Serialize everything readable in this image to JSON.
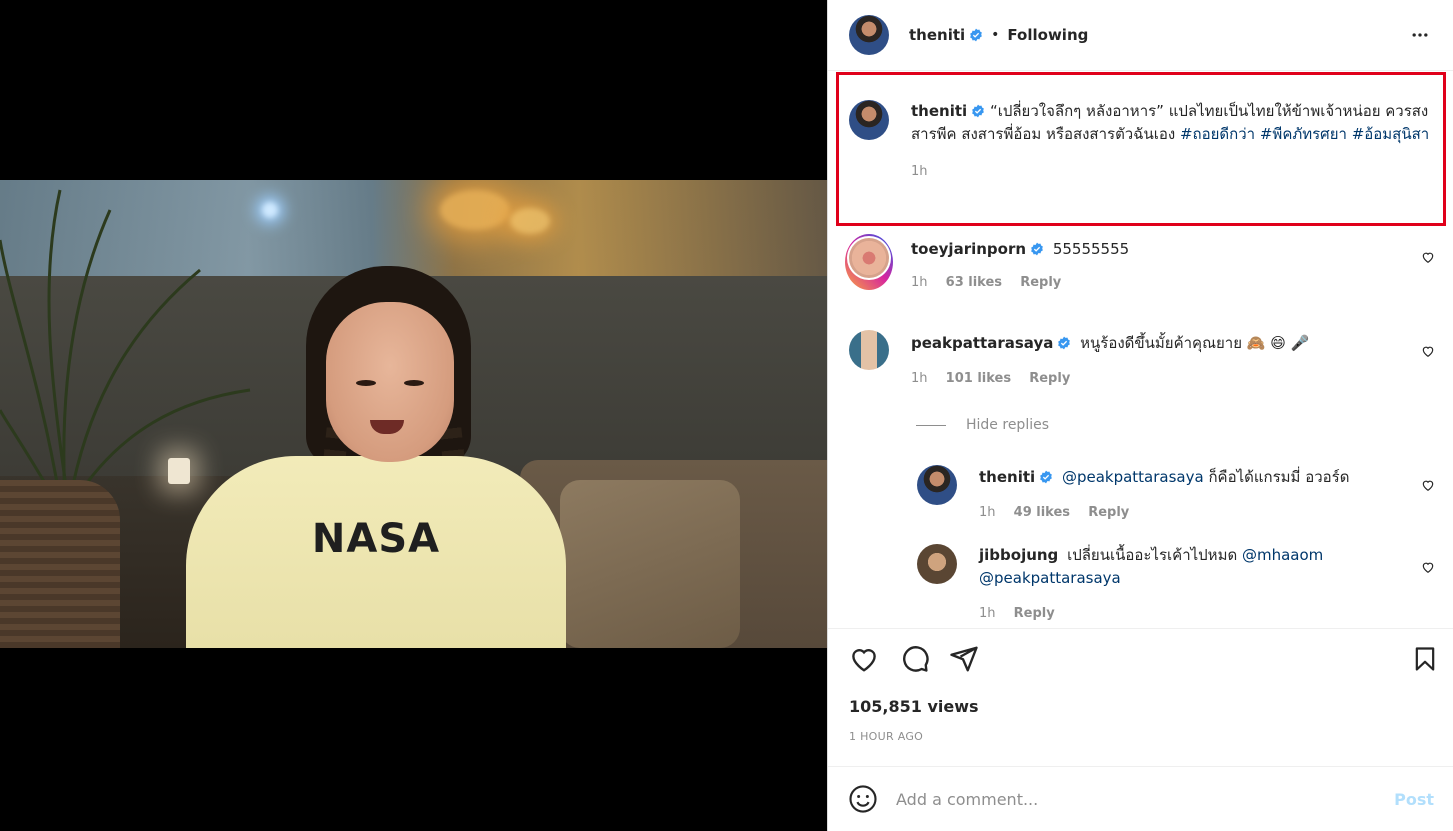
{
  "video": {
    "shirt_text": "NASA"
  },
  "header": {
    "username": "theniti",
    "separator": "•",
    "follow_status": "Following",
    "more_icon": "more-horizontal-icon"
  },
  "caption": {
    "username": "theniti",
    "text": "“เปลี่ยวใจลึกๆ หลังอาหาร” แปลไทยเป็นไทยให้ข้าพเจ้าหน่อย ควรสงสารพีค สงสารพี่อ้อม หรือสงสารตัวฉันเอง",
    "hashtags": [
      "#ถอยดีกว่า",
      "#พีคภัทรศยา",
      "#อ้อมสุนิสา"
    ],
    "time": "1h"
  },
  "comments": [
    {
      "username": "toeyjarinporn",
      "text": "55555555",
      "time": "1h",
      "likes": "63 likes",
      "reply": "Reply"
    },
    {
      "username": "peakpattarasaya",
      "text": "หนูร้องดีขึ้นมั้ยค้าคุณยาย 🙈 😄 🎤",
      "time": "1h",
      "likes": "101 likes",
      "reply": "Reply"
    }
  ],
  "hide_replies": "Hide replies",
  "replies": [
    {
      "username": "theniti",
      "mention": "@peakpattarasaya",
      "text": "ก็คือได้แกรมมี่ อวอร์ด",
      "time": "1h",
      "likes": "49 likes",
      "reply": "Reply"
    },
    {
      "username": "jibbojung",
      "text": "เปลี่ยนเนื้ออะไรเค้าไปหมด",
      "mention1": "@mhaaom",
      "mention2": "@peakpattarasaya",
      "time": "1h",
      "reply": "Reply"
    }
  ],
  "stats": {
    "views": "105,851 views",
    "posted": "1 HOUR AGO"
  },
  "add_comment": {
    "placeholder": "Add a comment...",
    "post_label": "Post"
  },
  "colors": {
    "verified": "#3897f0",
    "highlight_border": "#e0001a",
    "link": "#00376b",
    "post_disabled": "#b2dffc"
  }
}
